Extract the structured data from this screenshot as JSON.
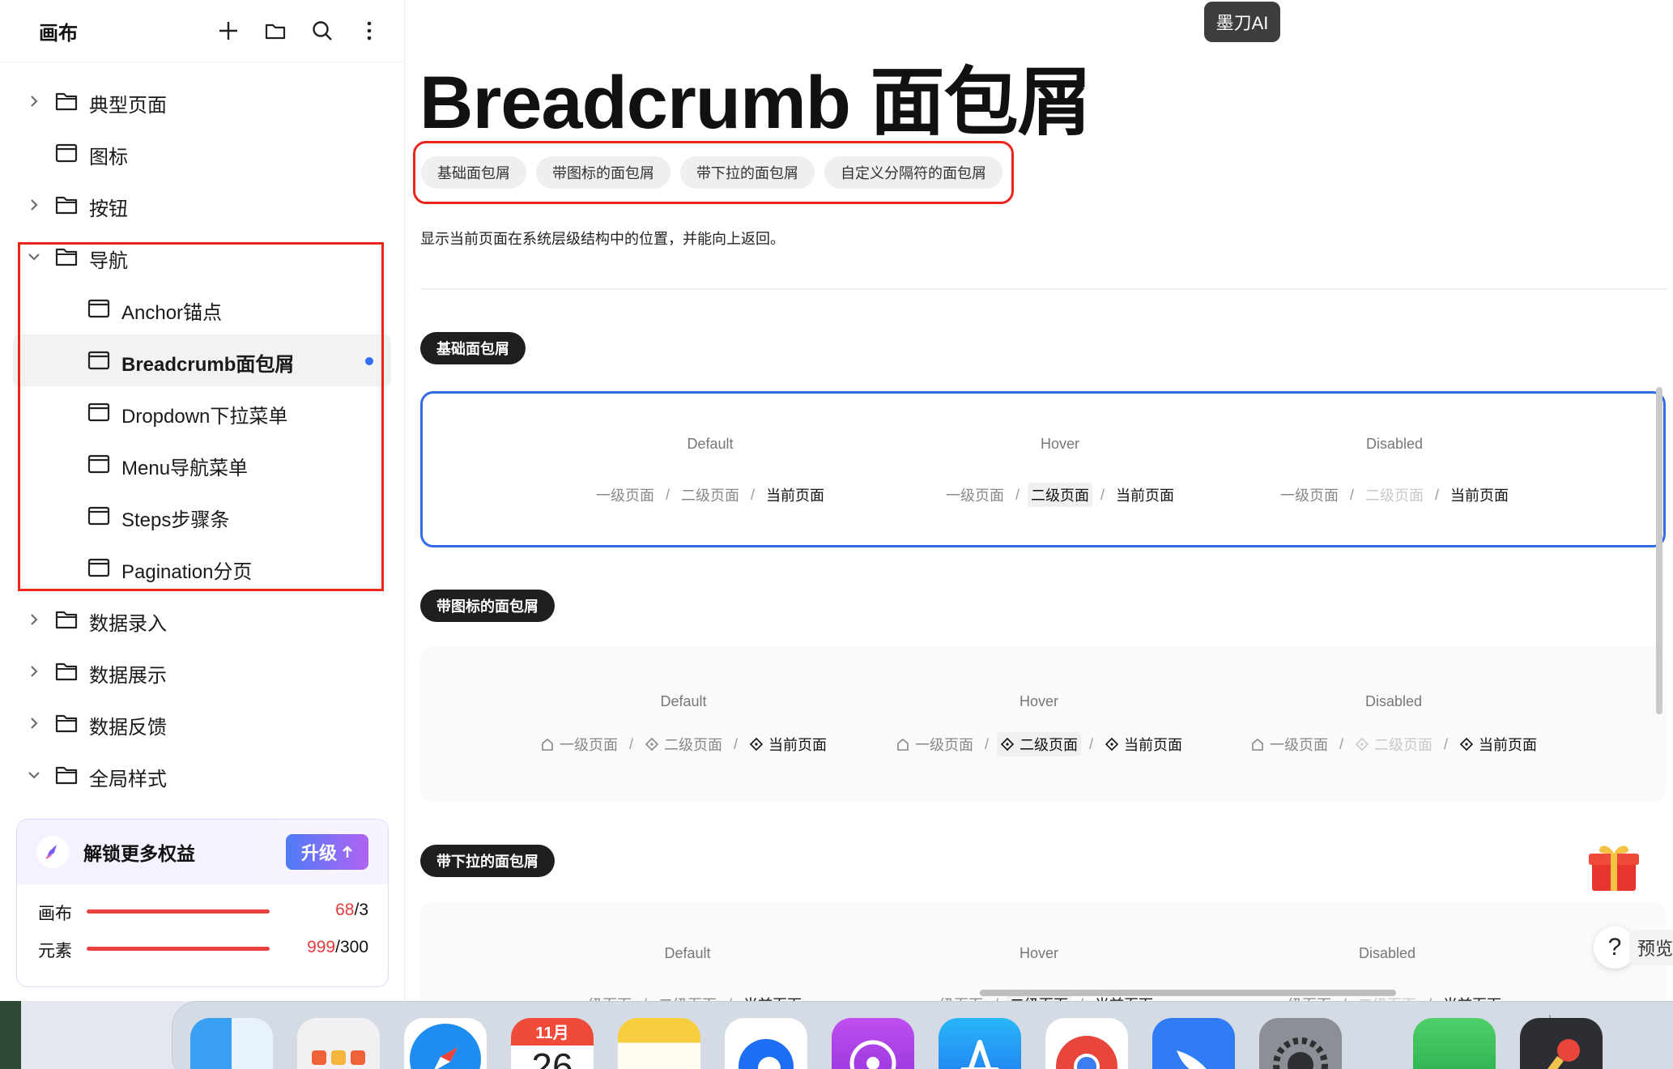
{
  "sidebar": {
    "title": "画布",
    "tree": [
      {
        "label": "典型页面",
        "type": "folder",
        "expanded": false
      },
      {
        "label": "图标",
        "type": "page"
      },
      {
        "label": "按钮",
        "type": "folder",
        "expanded": false
      },
      {
        "label": "导航",
        "type": "folder",
        "expanded": true
      },
      {
        "label": "Anchor锚点",
        "type": "page"
      },
      {
        "label": "Breadcrumb面包屑",
        "type": "page",
        "active": true
      },
      {
        "label": "Dropdown下拉菜单",
        "type": "page"
      },
      {
        "label": "Menu导航菜单",
        "type": "page"
      },
      {
        "label": "Steps步骤条",
        "type": "page"
      },
      {
        "label": "Pagination分页",
        "type": "page"
      },
      {
        "label": "数据录入",
        "type": "folder",
        "expanded": false
      },
      {
        "label": "数据展示",
        "type": "folder",
        "expanded": false
      },
      {
        "label": "数据反馈",
        "type": "folder",
        "expanded": false
      },
      {
        "label": "全局样式",
        "type": "folder",
        "expanded": true
      }
    ],
    "upgrade": {
      "title": "解锁更多权益",
      "button": "升级",
      "canvas_label": "画布",
      "canvas_used": "68",
      "canvas_limit": "/3",
      "element_label": "元素",
      "element_used": "999",
      "element_limit": "/300"
    }
  },
  "main": {
    "ai_badge": "墨刀AI",
    "title": "Breadcrumb 面包屑",
    "tabs": [
      "基础面包屑",
      "带图标的面包屑",
      "带下拉的面包屑",
      "自定义分隔符的面包屑"
    ],
    "description": "显示当前页面在系统层级结构中的位置，并能向上返回。",
    "states": {
      "default": "Default",
      "hover": "Hover",
      "disabled": "Disabled"
    },
    "crumbs": {
      "level1": "一级页面",
      "level2": "二级页面",
      "current": "当前页面",
      "sep": "/"
    },
    "sections": [
      {
        "label": "基础面包屑"
      },
      {
        "label": "带图标的面包屑"
      },
      {
        "label": "带下拉的面包屑"
      }
    ],
    "help": "?",
    "preview": "预览"
  },
  "dock": {
    "calendar_month": "11月",
    "calendar_day": "26"
  },
  "colors": {
    "highlight_red": "#e8261c",
    "selection_blue": "#2f6ce5",
    "active_dot": "#2d6ff7",
    "pill_dark": "#1f1f1f"
  }
}
